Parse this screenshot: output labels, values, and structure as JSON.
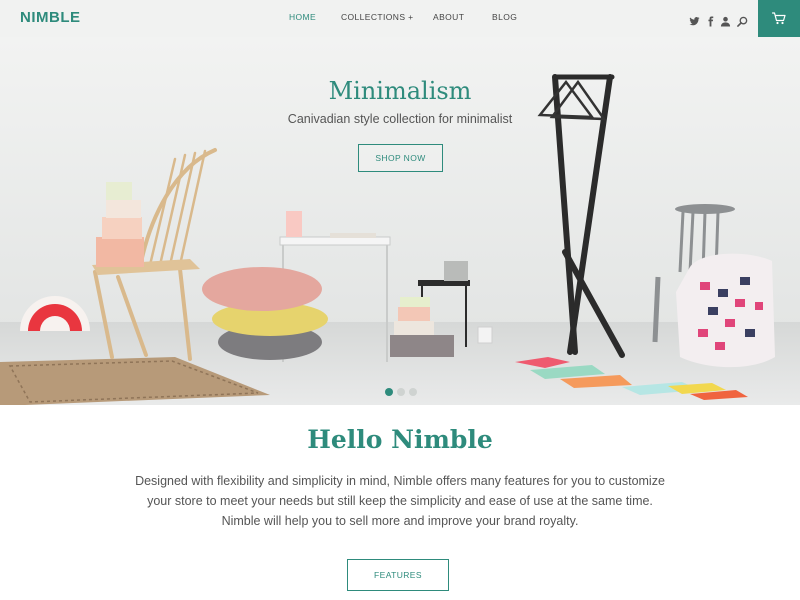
{
  "brand": {
    "logo_text": "NIMBLE",
    "accent_color": "#2e8b7c"
  },
  "nav": {
    "items": [
      {
        "label": "HOME",
        "active": true
      },
      {
        "label": "COLLECTIONS +",
        "active": false
      },
      {
        "label": "ABOUT",
        "active": false
      },
      {
        "label": "BLOG",
        "active": false
      }
    ],
    "icons": [
      "twitter-icon",
      "facebook-icon",
      "account-icon",
      "search-icon"
    ],
    "cart_icon": "cart-icon"
  },
  "hero": {
    "title": "Minimalism",
    "subtitle": "Canivadian style collection for minimalist",
    "button_label": "SHOP NOW",
    "slides_total": 3,
    "active_slide": 1
  },
  "intro": {
    "title": "Hello Nimble",
    "lines": [
      "Designed with flexibility and simplicity in mind, Nimble offers many features for you to customize",
      "your store to meet your needs but still keep the simplicity and ease of use at the same time.",
      "Nimble will help you to sell more and improve your brand royalty."
    ],
    "button_label": "FEATURES"
  }
}
